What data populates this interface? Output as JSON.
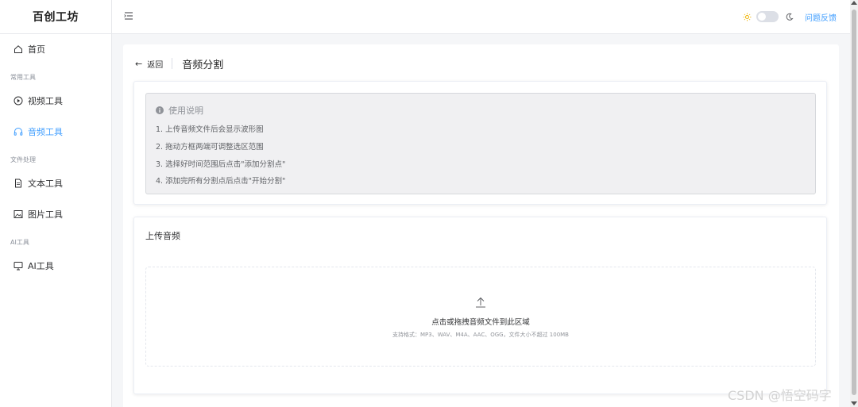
{
  "brand": "百创工坊",
  "sidebar": {
    "home": "首页",
    "group_common": "常用工具",
    "video": "视频工具",
    "audio": "音频工具",
    "group_file": "文件处理",
    "text": "文本工具",
    "image": "图片工具",
    "group_ai": "AI工具",
    "ai": "AI工具"
  },
  "header": {
    "feedback": "问题反馈"
  },
  "page": {
    "back": "返回",
    "title": "音频分割"
  },
  "instructions": {
    "title": "使用说明",
    "lines": [
      "1.  上传音频文件后会显示波形图",
      "2.  拖动方框两端可调整选区范围",
      "3.  选择好时间范围后点击\"添加分割点\"",
      "4.  添加完所有分割点后点击\"开始分割\""
    ]
  },
  "upload": {
    "title": "上传音频",
    "main_text": "点击或拖拽音频文件到此区域",
    "hint": "支持格式：MP3、WAV、M4A、AAC、OGG，文件大小不超过 100MB"
  },
  "watermark": "CSDN @悟空码字",
  "colors": {
    "accent": "#409eff",
    "sidebar_bg": "#ffffff",
    "page_bg": "#f5f6f8",
    "info_bg": "#f0f0f2"
  }
}
